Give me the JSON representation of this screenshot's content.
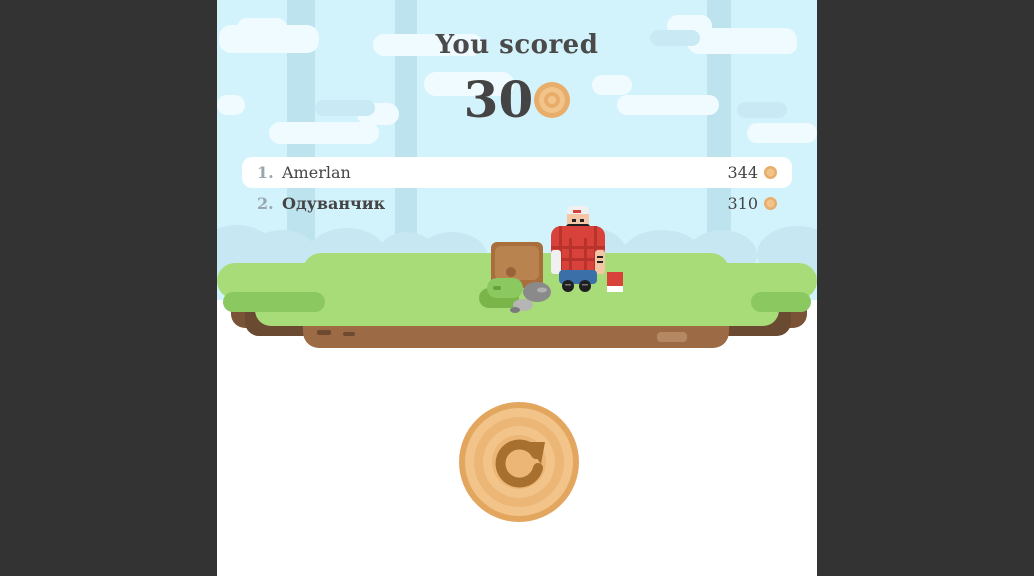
{
  "result": {
    "title": "You scored",
    "score": "30"
  },
  "leaderboard": [
    {
      "rank": "1.",
      "name": "Amerlan",
      "score": "344"
    },
    {
      "rank": "2.",
      "name": "Одуванчик",
      "score": "310"
    }
  ],
  "colors": {
    "sky": "#d3f3fc",
    "grass": "#a8dc78",
    "dirt": "#9c6a45",
    "coin": "#e8ad6a",
    "shirt_red": "#d9423a"
  },
  "icons": {
    "coin": "wood-ring-coin-icon",
    "restart": "restart-arrow-icon"
  }
}
